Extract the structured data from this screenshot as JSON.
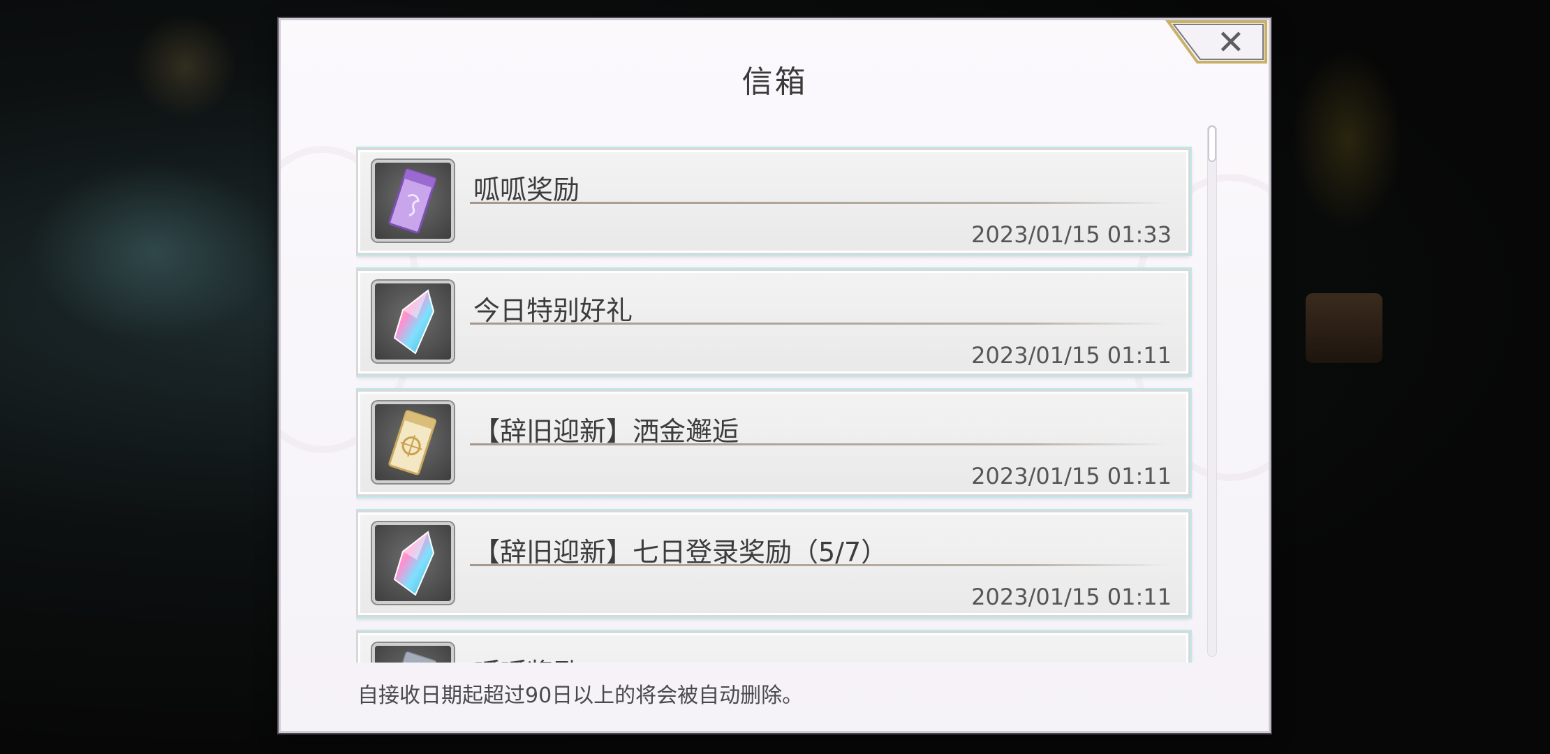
{
  "modal": {
    "title": "信箱",
    "close_icon": "close-icon",
    "footer_note": "自接收日期起超过90日以上的将会被自动删除。"
  },
  "mail_items": [
    {
      "title": "呱呱奖励",
      "date": "2023/01/15 01:33",
      "icon": "ticket-purple-icon"
    },
    {
      "title": "今日特别好礼",
      "date": "2023/01/15 01:11",
      "icon": "rainbow-crystal-icon"
    },
    {
      "title": "【辞旧迎新】洒金邂逅",
      "date": "2023/01/15 01:11",
      "icon": "ticket-gold-icon"
    },
    {
      "title": "【辞旧迎新】七日登录奖励（5/7）",
      "date": "2023/01/15 01:11",
      "icon": "rainbow-crystal-icon"
    },
    {
      "title": "呱呱奖励",
      "date": "",
      "icon": "ticket-silver-icon"
    }
  ],
  "colors": {
    "panel_bg": "#f8f6fa",
    "item_glow": "#bde9ec",
    "divider": "#a6988d",
    "close_border": "#c8b066"
  }
}
